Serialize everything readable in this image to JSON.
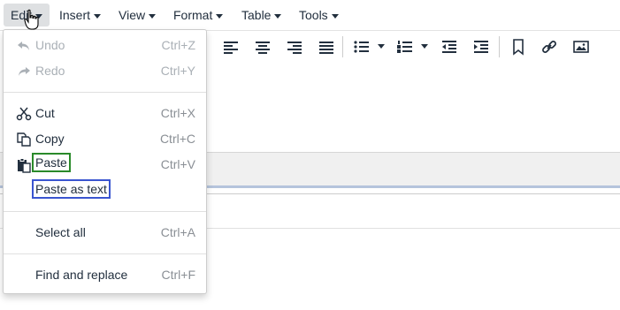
{
  "menubar": {
    "items": [
      {
        "label": "Edit"
      },
      {
        "label": "Insert"
      },
      {
        "label": "View"
      },
      {
        "label": "Format"
      },
      {
        "label": "Table"
      },
      {
        "label": "Tools"
      }
    ]
  },
  "edit_menu": {
    "items": [
      {
        "label": "Undo",
        "shortcut": "Ctrl+Z",
        "icon": "undo-icon",
        "disabled": true
      },
      {
        "label": "Redo",
        "shortcut": "Ctrl+Y",
        "icon": "redo-icon",
        "disabled": true
      },
      {
        "label": "Cut",
        "shortcut": "Ctrl+X",
        "icon": "cut-icon"
      },
      {
        "label": "Copy",
        "shortcut": "Ctrl+C",
        "icon": "copy-icon"
      },
      {
        "label": "Paste",
        "shortcut": "Ctrl+V",
        "icon": "paste-icon",
        "highlight": "#2a8a2a"
      },
      {
        "label": "Paste as text",
        "shortcut": "",
        "highlight": "#3a55d0"
      },
      {
        "label": "Select all",
        "shortcut": "Ctrl+A"
      },
      {
        "label": "Find and replace",
        "shortcut": "Ctrl+F"
      }
    ]
  },
  "toolbar": {
    "icons": [
      "align-left-icon",
      "align-center-icon",
      "align-right-icon",
      "align-justify-icon",
      "bullet-list-icon",
      "numbered-list-icon",
      "outdent-icon",
      "indent-icon",
      "bookmark-icon",
      "link-icon",
      "image-icon"
    ]
  },
  "colors": {
    "text": "#222f3e",
    "shortcut": "#8a8f95",
    "disabled": "#aab0b6",
    "paste_highlight": "#2a8a2a",
    "paste_text_highlight": "#3a55d0"
  }
}
